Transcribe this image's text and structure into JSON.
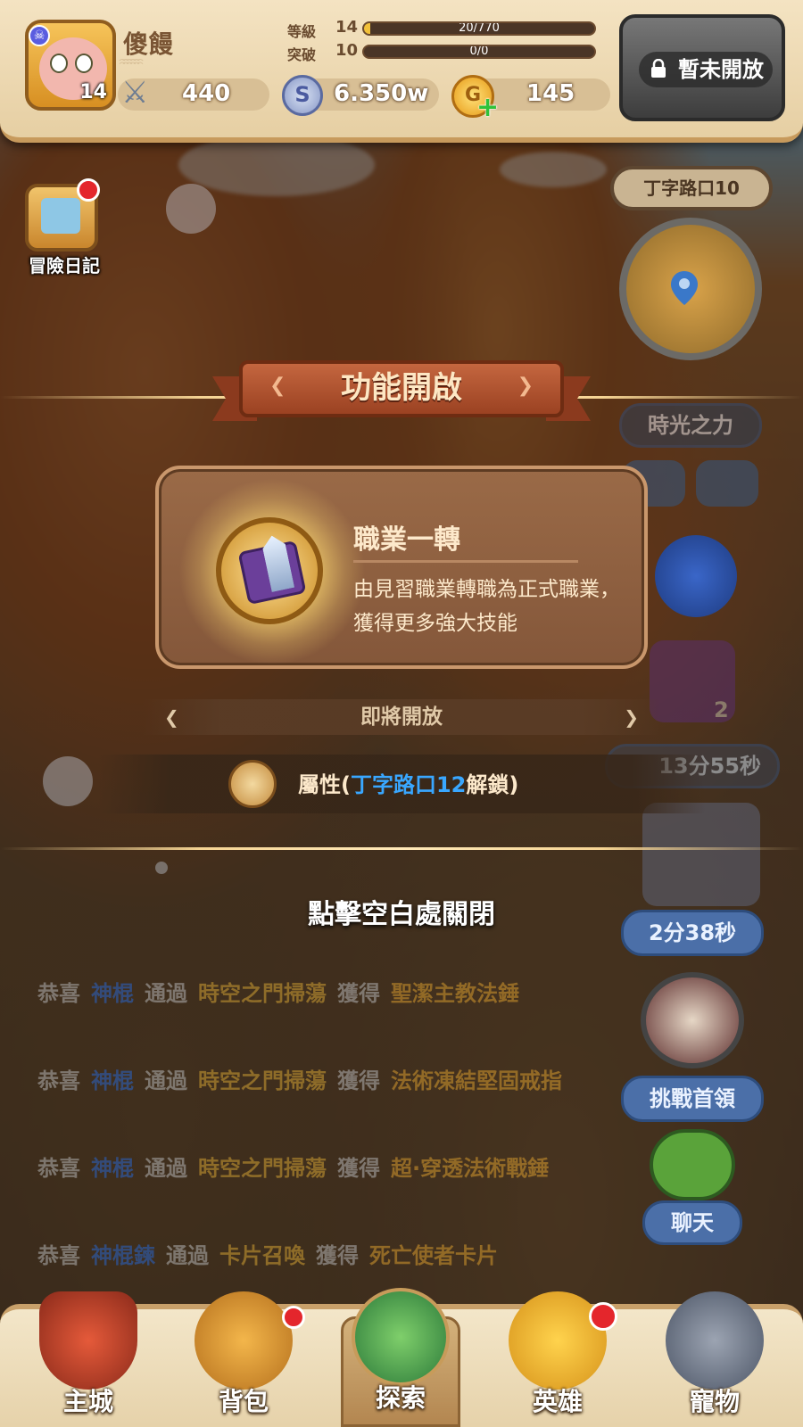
{
  "player": {
    "name": "傻饅",
    "level": "14",
    "power": "440",
    "grade_label": "等級",
    "grade_value": "14",
    "grade_exp": "20/770",
    "grade_progress": 0.026,
    "break_label": "突破",
    "break_value": "10",
    "break_exp": "0/0",
    "break_progress": 0
  },
  "currency": {
    "silver": "6.350w",
    "gold": "145",
    "silver_icon": "silver-coin-icon",
    "gold_icon": "gold-coin-icon"
  },
  "locked_feature": {
    "label": "暫未開放"
  },
  "left_panel": {
    "diary_label": "冒險日記"
  },
  "right_panel": {
    "location": "丁字路口10",
    "time_power": "時光之力",
    "timer1": "13分55秒",
    "timer2": "2分38秒",
    "boss": "挑戰首領",
    "chat": "聊天",
    "count_badge": "2"
  },
  "popup": {
    "title": "功能開啟",
    "job_name": "職業一轉",
    "job_desc": "由見習職業轉職為正式職業，獲得更多強大技能",
    "soon_label": "即將開放",
    "attr_prefix": "屬性(",
    "attr_highlight": "丁字路口12",
    "attr_suffix": "解鎖)",
    "close_hint": "點擊空白處關閉"
  },
  "ticker": [
    {
      "w1": "恭喜",
      "name": "神棍",
      "w2": "通過",
      "mode": "時空之門掃蕩",
      "w3": "獲得",
      "reward": "聖潔主教法錘"
    },
    {
      "w1": "恭喜",
      "name": "神棍",
      "w2": "通過",
      "mode": "時空之門掃蕩",
      "w3": "獲得",
      "reward": "法術凍結堅固戒指"
    },
    {
      "w1": "恭喜",
      "name": "神棍",
      "w2": "通過",
      "mode": "時空之門掃蕩",
      "w3": "獲得",
      "reward": "超·穿透法術戰錘"
    },
    {
      "w1": "恭喜",
      "name": "神棍鍊",
      "w2": "通過",
      "mode": "卡片召喚",
      "w3": "獲得",
      "reward": "死亡使者卡片"
    }
  ],
  "nav": [
    {
      "label": "主城",
      "icon": "castle-icon"
    },
    {
      "label": "背包",
      "icon": "backpack-icon"
    },
    {
      "label": "探索",
      "icon": "map-icon"
    },
    {
      "label": "英雄",
      "icon": "hero-icon"
    },
    {
      "label": "寵物",
      "icon": "pet-lock-icon"
    }
  ],
  "colors": {
    "accent_blue": "#39a7ff",
    "ribbon_red": "#9b4222",
    "gold": "#f2c13a"
  }
}
